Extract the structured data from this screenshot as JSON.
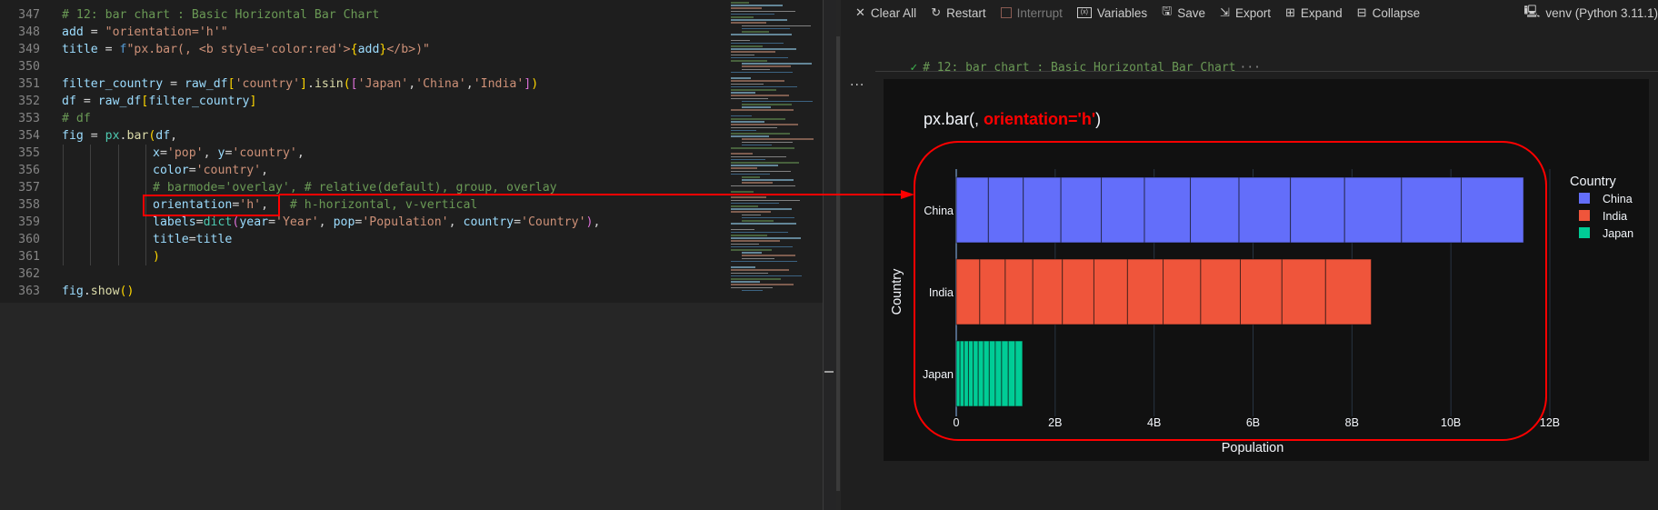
{
  "editor": {
    "lines": [
      {
        "n": "347",
        "indent": 0,
        "tokens": [
          [
            "cm",
            "# 12: bar chart : Basic Horizontal Bar Chart"
          ]
        ]
      },
      {
        "n": "348",
        "indent": 0,
        "tokens": [
          [
            "vr",
            "add"
          ],
          [
            "op",
            " = "
          ],
          [
            "st",
            "\"orientation='h'\""
          ]
        ]
      },
      {
        "n": "349",
        "indent": 0,
        "tokens": [
          [
            "vr",
            "title"
          ],
          [
            "op",
            " = "
          ],
          [
            "kw",
            "f"
          ],
          [
            "st",
            "\"px.bar(, <b style='color:red'>"
          ],
          [
            "b1",
            "{"
          ],
          [
            "vr",
            "add"
          ],
          [
            "b1",
            "}"
          ],
          [
            "st",
            "</b>)\""
          ]
        ]
      },
      {
        "n": "350",
        "indent": 0,
        "tokens": []
      },
      {
        "n": "351",
        "indent": 0,
        "tokens": [
          [
            "vr",
            "filter_country"
          ],
          [
            "op",
            " = "
          ],
          [
            "vr",
            "raw_df"
          ],
          [
            "b1",
            "["
          ],
          [
            "st",
            "'country'"
          ],
          [
            "b1",
            "]"
          ],
          [
            "op",
            "."
          ],
          [
            "fn",
            "isin"
          ],
          [
            "b1",
            "("
          ],
          [
            "b2",
            "["
          ],
          [
            "st",
            "'Japan'"
          ],
          [
            "op",
            ","
          ],
          [
            "st",
            "'China'"
          ],
          [
            "op",
            ","
          ],
          [
            "st",
            "'India'"
          ],
          [
            "b2",
            "]"
          ],
          [
            "b1",
            ")"
          ]
        ]
      },
      {
        "n": "352",
        "indent": 0,
        "tokens": [
          [
            "vr",
            "df"
          ],
          [
            "op",
            " = "
          ],
          [
            "vr",
            "raw_df"
          ],
          [
            "b1",
            "["
          ],
          [
            "vr",
            "filter_country"
          ],
          [
            "b1",
            "]"
          ]
        ]
      },
      {
        "n": "353",
        "indent": 0,
        "tokens": [
          [
            "cm",
            "# df"
          ]
        ]
      },
      {
        "n": "354",
        "indent": 0,
        "tokens": [
          [
            "vr",
            "fig"
          ],
          [
            "op",
            " = "
          ],
          [
            "cls",
            "px"
          ],
          [
            "op",
            "."
          ],
          [
            "fn",
            "bar"
          ],
          [
            "b1",
            "("
          ],
          [
            "vr",
            "df"
          ],
          [
            "op",
            ","
          ]
        ]
      },
      {
        "n": "355",
        "indent": 1,
        "tokens": [
          [
            "vr",
            "x"
          ],
          [
            "op",
            "="
          ],
          [
            "st",
            "'pop'"
          ],
          [
            "op",
            ", "
          ],
          [
            "vr",
            "y"
          ],
          [
            "op",
            "="
          ],
          [
            "st",
            "'country'"
          ],
          [
            "op",
            ","
          ]
        ]
      },
      {
        "n": "356",
        "indent": 1,
        "tokens": [
          [
            "vr",
            "color"
          ],
          [
            "op",
            "="
          ],
          [
            "st",
            "'country'"
          ],
          [
            "op",
            ","
          ]
        ]
      },
      {
        "n": "357",
        "indent": 1,
        "tokens": [
          [
            "cm",
            "# barmode='overlay', # relative(default), group, overlay"
          ]
        ]
      },
      {
        "n": "358",
        "indent": 1,
        "tokens": [
          [
            "vr",
            "orientation"
          ],
          [
            "op",
            "="
          ],
          [
            "st",
            "'h'"
          ],
          [
            "op",
            ",   "
          ],
          [
            "cm",
            "# h-horizontal, v-vertical"
          ]
        ]
      },
      {
        "n": "359",
        "indent": 1,
        "tokens": [
          [
            "vr",
            "labels"
          ],
          [
            "op",
            "="
          ],
          [
            "cls",
            "dict"
          ],
          [
            "b2",
            "("
          ],
          [
            "vr",
            "year"
          ],
          [
            "op",
            "="
          ],
          [
            "st",
            "'Year'"
          ],
          [
            "op",
            ", "
          ],
          [
            "vr",
            "pop"
          ],
          [
            "op",
            "="
          ],
          [
            "st",
            "'Population'"
          ],
          [
            "op",
            ", "
          ],
          [
            "vr",
            "country"
          ],
          [
            "op",
            "="
          ],
          [
            "st",
            "'Country'"
          ],
          [
            "b2",
            ")"
          ],
          [
            "op",
            ","
          ]
        ]
      },
      {
        "n": "360",
        "indent": 1,
        "tokens": [
          [
            "vr",
            "title"
          ],
          [
            "op",
            "="
          ],
          [
            "vr",
            "title"
          ]
        ]
      },
      {
        "n": "361",
        "indent": 1,
        "tokens": [
          [
            "b1",
            ")"
          ]
        ]
      },
      {
        "n": "362",
        "indent": 0,
        "tokens": []
      },
      {
        "n": "363",
        "indent": 0,
        "tokens": [
          [
            "vr",
            "fig"
          ],
          [
            "op",
            "."
          ],
          [
            "fn",
            "show"
          ],
          [
            "b1",
            "()"
          ]
        ]
      }
    ]
  },
  "toolbar": {
    "clear_all": "Clear All",
    "restart": "Restart",
    "interrupt": "Interrupt",
    "variables": "Variables",
    "save": "Save",
    "export": "Export",
    "expand": "Expand",
    "collapse": "Collapse",
    "kernel": "venv (Python 3.11.1)"
  },
  "cell": {
    "header": "# 12: bar chart : Basic Horizontal Bar Chart",
    "more": "···",
    "dots": "···"
  },
  "colors": {
    "china": "#636efa",
    "india": "#ef553b",
    "japan": "#00cc96",
    "annotation": "#ff0000",
    "plot_bg": "#111111"
  },
  "chart_data": {
    "type": "bar",
    "orientation": "h",
    "title_plain": "px.bar(, ",
    "title_highlight": "orientation='h'",
    "title_end": ")",
    "xlabel": "Population",
    "ylabel": "Country",
    "categories": [
      "China",
      "India",
      "Japan"
    ],
    "values": [
      11.47,
      8.39,
      1.34
    ],
    "value_units": "billions",
    "segments": [
      12,
      12,
      12
    ],
    "xlim": [
      0,
      12
    ],
    "xticks": [
      0,
      2,
      4,
      6,
      8,
      10,
      12
    ],
    "xtick_labels": [
      "0",
      "2B",
      "4B",
      "6B",
      "8B",
      "10B",
      "12B"
    ],
    "grid": true,
    "legend": {
      "title": "Country",
      "placement": "right",
      "items": [
        "China",
        "India",
        "Japan"
      ]
    }
  }
}
